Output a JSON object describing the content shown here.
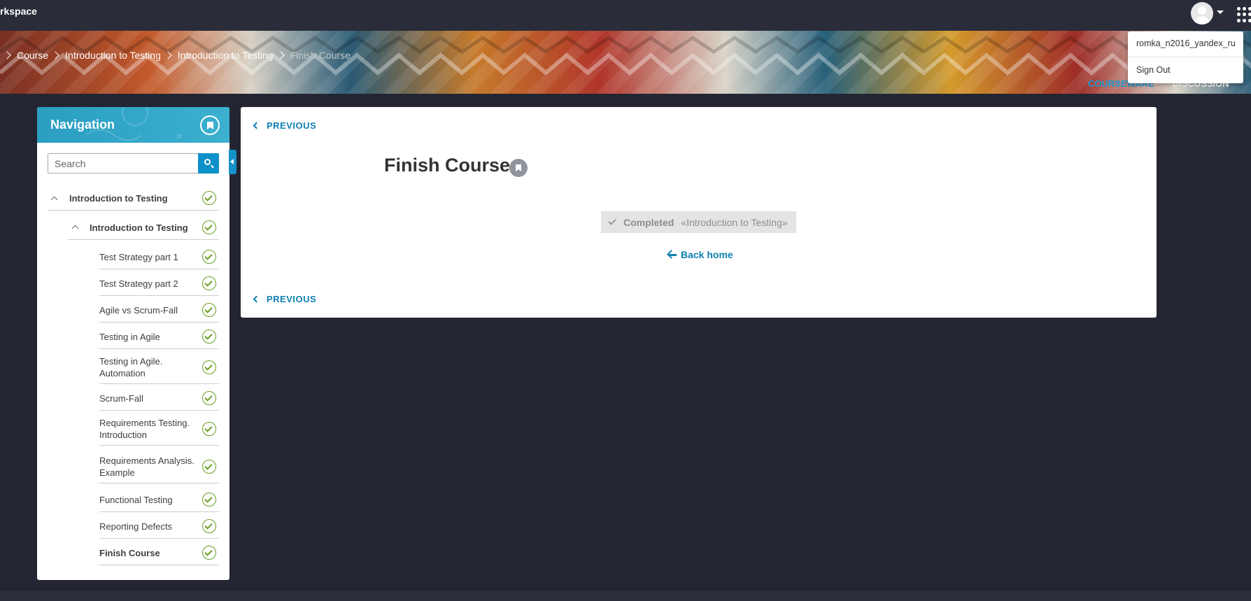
{
  "topbar": {
    "brand": "rkspace"
  },
  "breadcrumb": [
    "Course",
    "Introduction to Testing",
    "Introduction to Testing",
    "Finish Course"
  ],
  "course_tabs": {
    "courseware": "COURSEWARE",
    "discussion": "DISCUSSION"
  },
  "user_menu": {
    "username": "romka_n2016_yandex_ru",
    "sign_out": "Sign Out"
  },
  "navigation": {
    "title": "Navigation",
    "search_placeholder": "Search",
    "section": "Introduction to Testing",
    "subsection": "Introduction to Testing",
    "units": [
      "Test Strategy part 1",
      "Test Strategy part 2",
      "Agile vs Scrum-Fall",
      "Testing in Agile",
      "Testing in Agile. Automation",
      "Scrum-Fall",
      "Requirements Testing. Introduction",
      "Requirements Analysis. Example",
      "Functional Testing",
      "Reporting Defects",
      "Finish Course"
    ]
  },
  "main": {
    "previous_label": "PREVIOUS",
    "unit_title": "Finish Course",
    "completed_label": "Completed",
    "completed_course": "«Introduction to Testing»",
    "back_home": "Back home"
  },
  "colors": {
    "accent": "#0d7fb0",
    "complete": "#689f1f",
    "page_bg": "#232632",
    "nav_header": "#2b9ec2"
  }
}
